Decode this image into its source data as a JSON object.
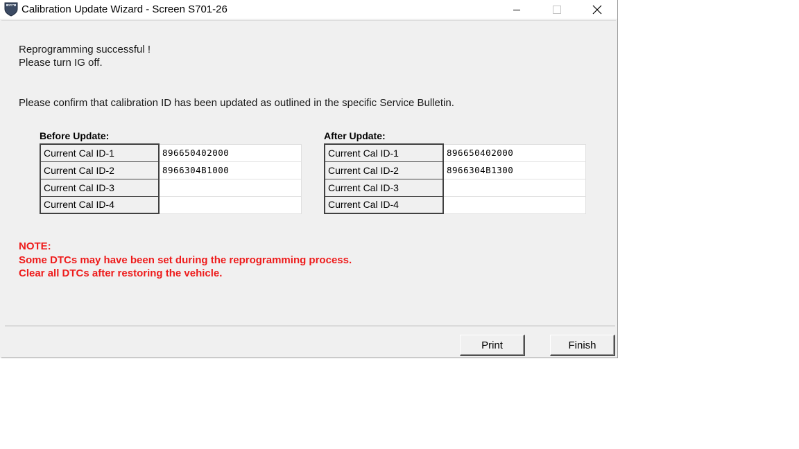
{
  "window": {
    "title": "Calibration Update Wizard - Screen S701-26",
    "icon": "cuw-shield-icon",
    "icon_text": "CUW"
  },
  "messages": {
    "line1": "Reprogramming successful !",
    "line2": "Please turn IG off.",
    "confirm": "Please confirm that calibration ID has been updated as outlined in the specific Service Bulletin."
  },
  "before": {
    "label": "Before Update:",
    "rows": [
      {
        "name": "Current Cal ID-1",
        "value": "896650402000"
      },
      {
        "name": "Current Cal ID-2",
        "value": "8966304B1000"
      },
      {
        "name": "Current Cal ID-3",
        "value": ""
      },
      {
        "name": "Current Cal ID-4",
        "value": ""
      }
    ]
  },
  "after": {
    "label": "After Update:",
    "rows": [
      {
        "name": "Current Cal ID-1",
        "value": "896650402000"
      },
      {
        "name": "Current Cal ID-2",
        "value": "8966304B1300"
      },
      {
        "name": "Current Cal ID-3",
        "value": ""
      },
      {
        "name": "Current Cal ID-4",
        "value": ""
      }
    ]
  },
  "note": {
    "heading": "NOTE:",
    "line1": "Some DTCs may have been set during the reprogramming process.",
    "line2": "Clear all DTCs after restoring the vehicle."
  },
  "buttons": {
    "print": "Print",
    "finish": "Finish"
  },
  "colors": {
    "note": "#ee1c1c",
    "window_bg": "#f0f0f0"
  }
}
